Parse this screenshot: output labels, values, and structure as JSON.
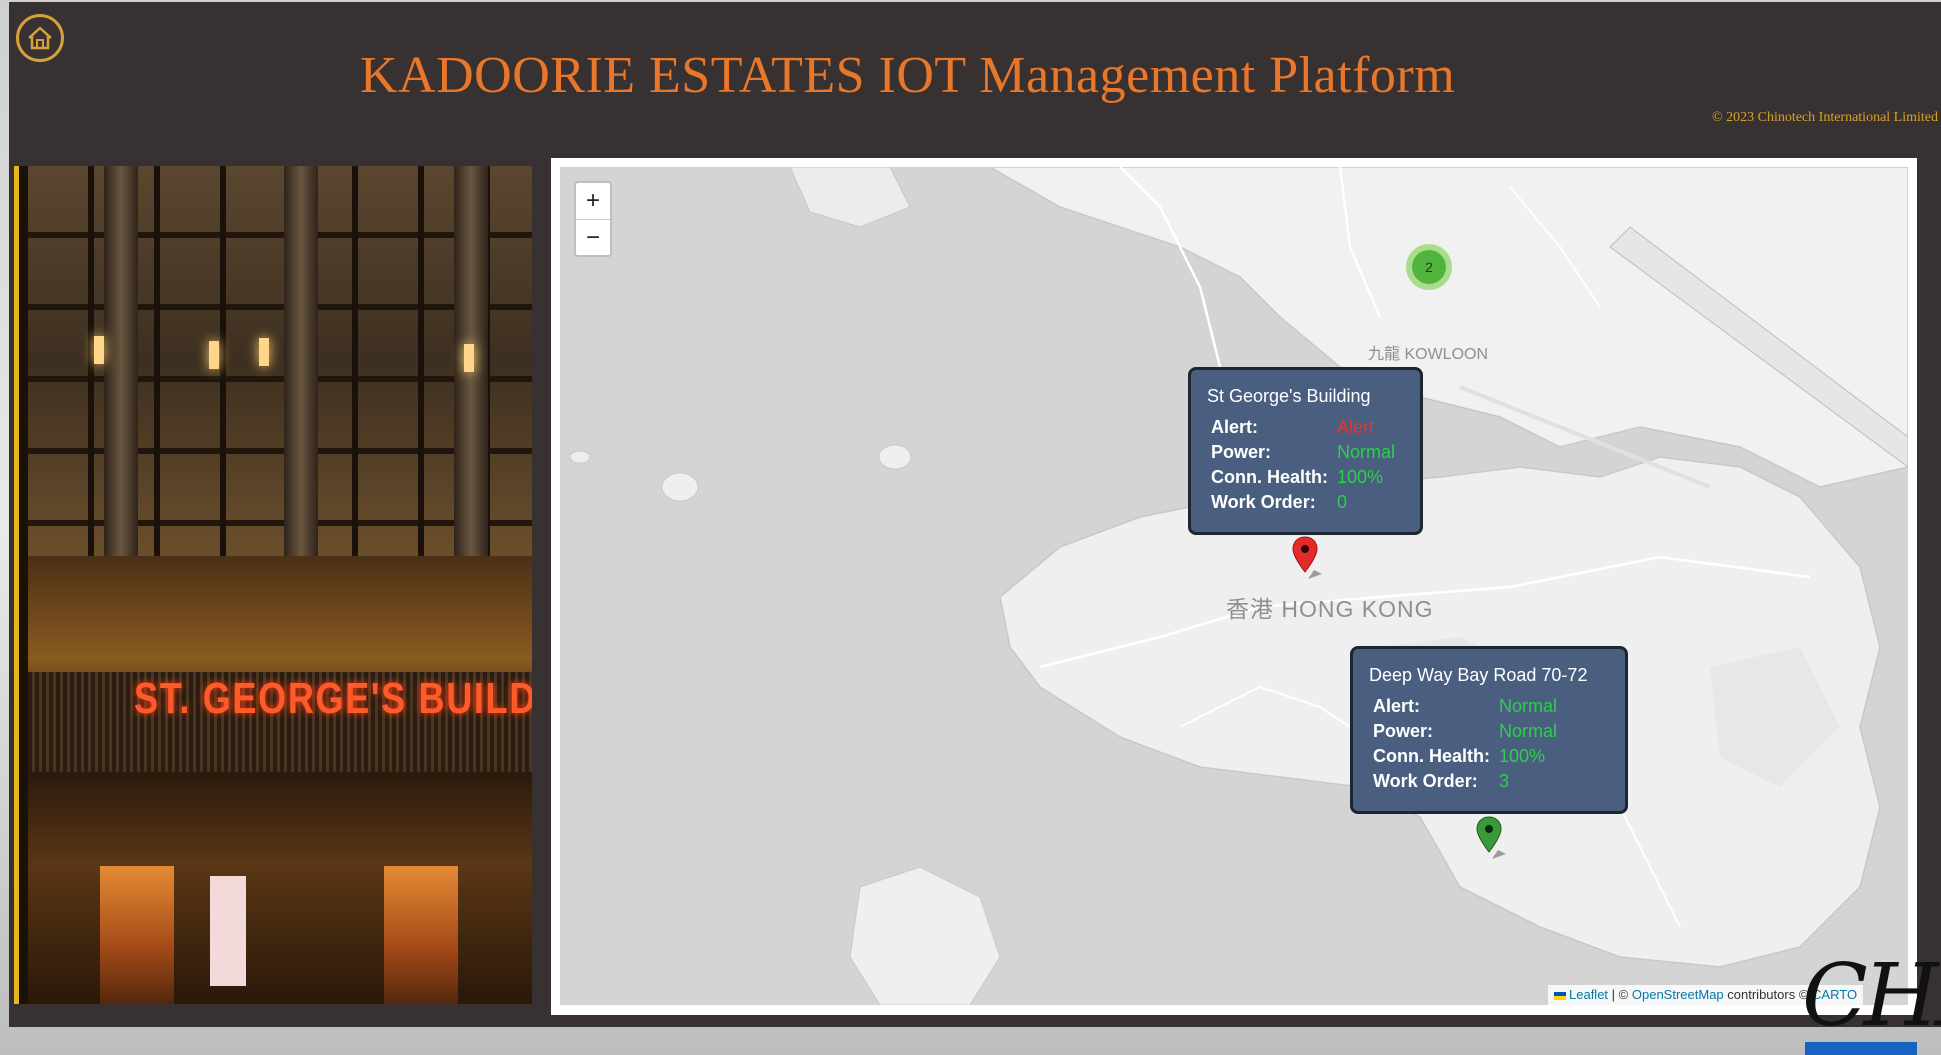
{
  "header": {
    "title": "KADOORIE ESTATES IOT Management Platform",
    "copyright": "© 2023 Chinotech International Limited",
    "home_icon": "home-icon"
  },
  "photo": {
    "sign_text": "ST. GEORGE'S BUILDING"
  },
  "map": {
    "zoom_in": "+",
    "zoom_out": "−",
    "labels": {
      "kowloon": "九龍 KOWLOON",
      "hong_kong": "香港 HONG KONG"
    },
    "cluster_count": "2",
    "popups": [
      {
        "title": "St George's Building",
        "alert_label": "Alert:",
        "alert_value": "Alert",
        "power_label": "Power:",
        "power_value": "Normal",
        "conn_label": "Conn. Health:",
        "conn_value": "100%",
        "work_label": "Work Order:",
        "work_value": "0",
        "marker_color": "#e52a2a"
      },
      {
        "title": "Deep Way Bay Road 70-72",
        "alert_label": "Alert:",
        "alert_value": "Normal",
        "power_label": "Power:",
        "power_value": "Normal",
        "conn_label": "Conn. Health:",
        "conn_value": "100%",
        "work_label": "Work Order:",
        "work_value": "3",
        "marker_color": "#3a9a3a"
      }
    ],
    "attribution": {
      "leaflet": "Leaflet",
      "separator": "| ©",
      "osm": "OpenStreetMap",
      "contributors": "contributors ©",
      "carto": "CARTO"
    }
  },
  "brand": {
    "logo_text": "CHI"
  },
  "colors": {
    "header_bg": "#383131",
    "title": "#e8772a",
    "copyright": "#d4a22a",
    "popup_bg": "#4a5f80",
    "ok": "#2bd04a",
    "alert": "#e8342a"
  }
}
